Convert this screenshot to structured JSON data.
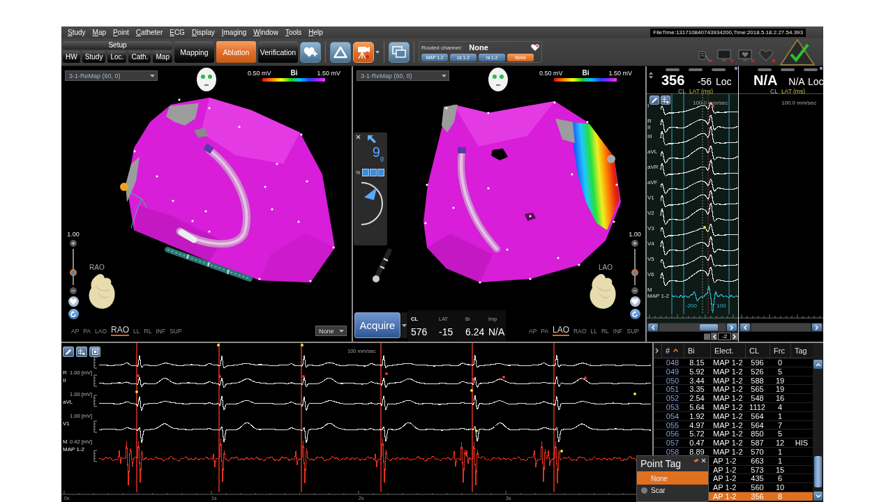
{
  "menu_bar": {
    "items": [
      "Study",
      "Map",
      "Point",
      "Catheter",
      "ECG",
      "Display",
      "Imaging",
      "Window",
      "Tools",
      "Help"
    ]
  },
  "file_time": "FileTime:131710840743934200,Time:2018.5.18.2.27.54.393",
  "toolbar": {
    "setup": {
      "title": "Setup",
      "buttons": [
        "HW",
        "Study",
        "Loc.",
        "Cath.",
        "Map"
      ]
    },
    "workflow_tabs": [
      {
        "label": "Mapping",
        "selected": false
      },
      {
        "label": "Ablation",
        "selected": true
      },
      {
        "label": "Verification",
        "selected": false
      }
    ],
    "tool_buttons": [
      {
        "active": false
      },
      {
        "active": false
      },
      {
        "active": true
      },
      {
        "active": false
      }
    ],
    "routed_channel": {
      "label": "Routed channel:",
      "value": "None",
      "channels": [
        {
          "label": "MAP 1-2",
          "selected": false
        },
        {
          "label": "cs 1-2",
          "selected": false
        },
        {
          "label": "ra 1-2",
          "selected": false
        },
        {
          "label": "None",
          "selected": true
        }
      ]
    }
  },
  "device_status": [
    {
      "fault": true
    },
    {
      "fault": true
    },
    {
      "fault": true
    },
    {
      "fault": true
    }
  ],
  "map_views": [
    {
      "map": "3-1-ReMap (60, 0)",
      "scale": {
        "min": "0.50 mV",
        "name": "Bi",
        "max": "1.50 mV"
      },
      "zoom": {
        "value": "1.00",
        "level": 0.3
      },
      "orientation": "RAO",
      "views": [
        {
          "label": "AP",
          "selected": false
        },
        {
          "label": "PA",
          "selected": false
        },
        {
          "label": "LAO",
          "selected": false
        },
        {
          "label": "RAO",
          "selected": true
        },
        {
          "label": "LL",
          "selected": false
        },
        {
          "label": "RL",
          "selected": false
        },
        {
          "label": "INF",
          "selected": false
        },
        {
          "label": "SUP",
          "selected": false
        }
      ],
      "layer": "None"
    },
    {
      "map": "3-1-ReMap (60, 0)",
      "scale": {
        "min": "0.50 mV",
        "name": "Bi",
        "max": "1.50 mV"
      },
      "zoom": {
        "value": "1.00",
        "level": 0.3
      },
      "orientation": "LAO",
      "views": [
        {
          "label": "AP",
          "selected": false
        },
        {
          "label": "PA",
          "selected": false
        },
        {
          "label": "LAO",
          "selected": true
        },
        {
          "label": "RAO",
          "selected": false
        },
        {
          "label": "LL",
          "selected": false
        },
        {
          "label": "RL",
          "selected": false
        },
        {
          "label": "INF",
          "selected": false
        },
        {
          "label": "SUP",
          "selected": false
        }
      ],
      "contact": {
        "force": "9$_{g}$",
        "percent": "%",
        "segments": [
          {
            "on": true
          },
          {
            "on": true
          },
          {
            "on": true
          }
        ]
      },
      "acquire": {
        "label": "Acquire"
      },
      "readings": [
        {
          "label": "CL",
          "value": "576"
        },
        {
          "label": "LAT",
          "value": "-15"
        },
        {
          "label": "Bi",
          "value": "6.24"
        },
        {
          "label": "Imp",
          "value": "N/A"
        }
      ]
    }
  ],
  "ecg_panel": {
    "columns": [
      {
        "cl": "356",
        "lat": "-56",
        "loc": "Loc",
        "cl_label": "CL",
        "lat_label": "LAT (ms)",
        "speed": "100.0 mm/sec",
        "leads": [
          {
            "name": "I",
            "kind": "surface",
            "color": "#e6e6e6"
          },
          {
            "tag": "R",
            "name": "II",
            "kind": "surface",
            "color": "#e6e6e6"
          },
          {
            "name": "III",
            "kind": "surface",
            "color": "#e6e6e6"
          },
          {
            "name": "aVL",
            "kind": "surface",
            "color": "#e6e6e6"
          },
          {
            "name": "aVR",
            "kind": "surface",
            "color": "#e6e6e6"
          },
          {
            "name": "aVF",
            "kind": "surface",
            "color": "#e6e6e6"
          },
          {
            "name": "V1",
            "kind": "surface",
            "color": "#e6e6e6"
          },
          {
            "name": "V2",
            "kind": "surface",
            "color": "#e6e6e6"
          },
          {
            "name": "V3",
            "kind": "surface",
            "color": "#e6e6e6"
          },
          {
            "name": "V4",
            "kind": "surface",
            "color": "#e6e6e6"
          },
          {
            "name": "V5",
            "kind": "surface",
            "color": "#e6e6e6"
          },
          {
            "name": "V6",
            "kind": "surface",
            "color": "#e6e6e6"
          },
          {
            "tag": "M",
            "name": "MAP 1-2",
            "kind": "intracardiac",
            "color": "#2eb6cc"
          }
        ],
        "annotations": [
          "-200",
          "100"
        ],
        "page": "-2"
      },
      {
        "cl": "N/A",
        "lat": "N/A",
        "loc": "Loc",
        "cl_label": "CL",
        "lat_label": "LAT (ms)",
        "speed": "100.0 mm/sec"
      }
    ]
  },
  "ecg_strip": {
    "speed": "100 mm/sec",
    "leads": [
      {
        "kind": "surface",
        "color": "#e6e6e6"
      },
      {
        "tag": "R",
        "name": "II",
        "scale": "1.00 [mV]",
        "kind": "surface",
        "color": "#e6e6e6"
      },
      {
        "name": "aVL",
        "scale": "1.00 [mV]",
        "kind": "surface",
        "color": "#e6e6e6"
      },
      {
        "name": "V1",
        "scale": "1.00 [mV]",
        "kind": "surface",
        "color": "#e6e6e6"
      },
      {
        "tag": "M",
        "name": "MAP 1-2",
        "scale": "0.42 [mV]",
        "kind": "intracardiac",
        "color": "#e8321e"
      }
    ],
    "time_labels": [
      "0s",
      "1s",
      "2s",
      "3s"
    ]
  },
  "points_table": {
    "columns": [
      {
        "label": "#",
        "sorted": true
      },
      {
        "label": "Bi",
        "sorted": false
      },
      {
        "label": "Elect.",
        "sorted": false
      },
      {
        "label": "CL",
        "sorted": false
      },
      {
        "label": "Frc",
        "sorted": false
      },
      {
        "label": "Tag",
        "sorted": false
      }
    ],
    "rows": [
      {
        "number": "048",
        "bi": "8.15",
        "electrode": "MAP 1-2",
        "cl": "596",
        "frc": "0",
        "selected": false
      },
      {
        "number": "049",
        "bi": "5.92",
        "electrode": "MAP 1-2",
        "cl": "526",
        "frc": "5",
        "selected": false
      },
      {
        "number": "050",
        "bi": "3.44",
        "electrode": "MAP 1-2",
        "cl": "588",
        "frc": "19",
        "selected": false
      },
      {
        "number": "051",
        "bi": "3.35",
        "electrode": "MAP 1-2",
        "cl": "565",
        "frc": "19",
        "selected": false
      },
      {
        "number": "052",
        "bi": "2.54",
        "electrode": "MAP 1-2",
        "cl": "548",
        "frc": "16",
        "selected": false
      },
      {
        "number": "053",
        "bi": "5.64",
        "electrode": "MAP 1-2",
        "cl": "1112",
        "frc": "4",
        "selected": false
      },
      {
        "number": "054",
        "bi": "1.92",
        "electrode": "MAP 1-2",
        "cl": "564",
        "frc": "1",
        "selected": false
      },
      {
        "number": "055",
        "bi": "4.97",
        "electrode": "MAP 1-2",
        "cl": "564",
        "frc": "7",
        "selected": false
      },
      {
        "number": "056",
        "bi": "5.72",
        "electrode": "MAP 1-2",
        "cl": "850",
        "frc": "5",
        "selected": false
      },
      {
        "number": "057",
        "bi": "0.47",
        "electrode": "MAP 1-2",
        "cl": "587",
        "frc": "12",
        "tag": "HIS",
        "selected": false
      },
      {
        "number": "058",
        "bi": "8.89",
        "electrode": "MAP 1-2",
        "cl": "570",
        "frc": "1",
        "selected": false
      },
      {
        "electrode": "AP 1-2",
        "cl": "663",
        "frc": "1",
        "selected": false
      },
      {
        "electrode": "AP 1-2",
        "cl": "573",
        "frc": "15",
        "selected": false
      },
      {
        "electrode": "AP 1-2",
        "cl": "435",
        "frc": "6",
        "selected": false
      },
      {
        "electrode": "AP 1-2",
        "cl": "560",
        "frc": "10",
        "selected": false
      },
      {
        "electrode": "AP 1-2",
        "cl": "356",
        "frc": "8",
        "selected": true
      }
    ]
  },
  "point_tag_popup": {
    "title": "Point Tag",
    "options": [
      {
        "label": "None",
        "selected": true
      },
      {
        "label": "Scar",
        "selected": false,
        "color": "#7a7a7a"
      }
    ]
  }
}
